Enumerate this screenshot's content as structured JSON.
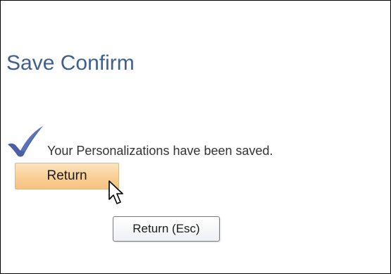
{
  "page": {
    "title": "Save Confirm",
    "message": "Your Personalizations have been saved."
  },
  "actions": {
    "return_label": "Return",
    "return_tooltip": "Return (Esc)"
  },
  "icons": {
    "status": "checkmark-icon",
    "pointer": "mouse-cursor-icon"
  },
  "colors": {
    "title": "#3f5f8f",
    "check": "#4a5fa8",
    "button_top": "#fde4bd",
    "button_bottom": "#f6c280"
  }
}
